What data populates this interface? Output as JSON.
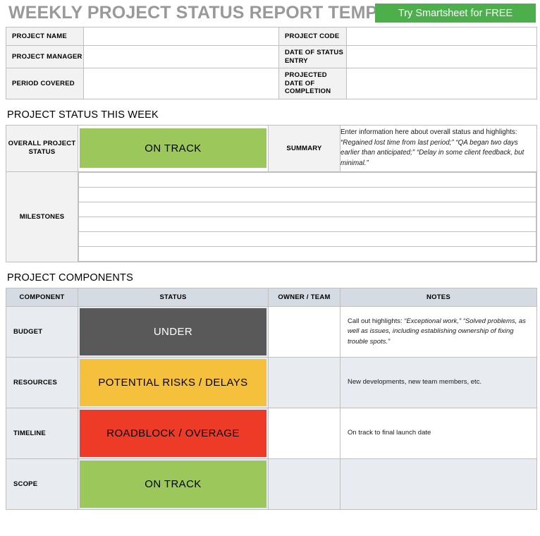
{
  "header": {
    "title": "WEEKLY PROJECT STATUS REPORT TEMPLATE",
    "cta_label": "Try Smartsheet for FREE",
    "title_color": "#999999",
    "cta_color": "#4CAF4C"
  },
  "info_table": {
    "rows": [
      {
        "left_label": "PROJECT NAME",
        "left_value": "",
        "right_label": "PROJECT CODE",
        "right_value": ""
      },
      {
        "left_label": "PROJECT MANAGER",
        "left_value": "",
        "right_label": "DATE OF STATUS ENTRY",
        "right_value": ""
      },
      {
        "left_label": "PERIOD COVERED",
        "left_value": "",
        "right_label": "PROJECTED DATE OF COMPLETION",
        "right_value": ""
      }
    ]
  },
  "status_section": {
    "heading": "PROJECT STATUS THIS WEEK",
    "overall_label": "OVERALL PROJECT STATUS",
    "overall_value": "ON TRACK",
    "overall_color": "#9CC75A",
    "summary_label": "SUMMARY",
    "summary_lead": "Enter information here about overall status and highlights: ",
    "summary_quote": "“Regained lost time from last period;” “QA began two days earlier than anticipated;” “Delay in some client feedback, but minimal.”",
    "milestones_label": "MILESTONES",
    "milestone_rows": [
      "",
      "",
      "",
      "",
      "",
      ""
    ]
  },
  "components_section": {
    "heading": "PROJECT COMPONENTS",
    "columns": [
      "COMPONENT",
      "STATUS",
      "OWNER / TEAM",
      "NOTES"
    ],
    "rows": [
      {
        "component": "BUDGET",
        "status": "UNDER",
        "status_color": "#595959",
        "status_text_color": "#ffffff",
        "owner": "",
        "owner_bg": "white",
        "notes_bg": "white",
        "notes_lead": "Call out highlights: ",
        "notes_quote": "“Exceptional work,” “Solved problems, as well as issues, including establishing ownership of fixing trouble spots.”"
      },
      {
        "component": "RESOURCES",
        "status": "POTENTIAL RISKS / DELAYS",
        "status_color": "#F5C03C",
        "status_text_color": "#000000",
        "owner": "",
        "owner_bg": "shaded",
        "notes_bg": "shaded",
        "notes_lead": "New developments, new team members, etc.",
        "notes_quote": ""
      },
      {
        "component": "TIMELINE",
        "status": "ROADBLOCK / OVERAGE",
        "status_color": "#EE3B28",
        "status_text_color": "#000000",
        "owner": "",
        "owner_bg": "white",
        "notes_bg": "white",
        "notes_lead": "On track to final launch date",
        "notes_quote": ""
      },
      {
        "component": "SCOPE",
        "status": "ON TRACK",
        "status_color": "#9CC75A",
        "status_text_color": "#000000",
        "owner": "",
        "owner_bg": "shaded",
        "notes_bg": "shaded",
        "notes_lead": "",
        "notes_quote": ""
      }
    ]
  }
}
